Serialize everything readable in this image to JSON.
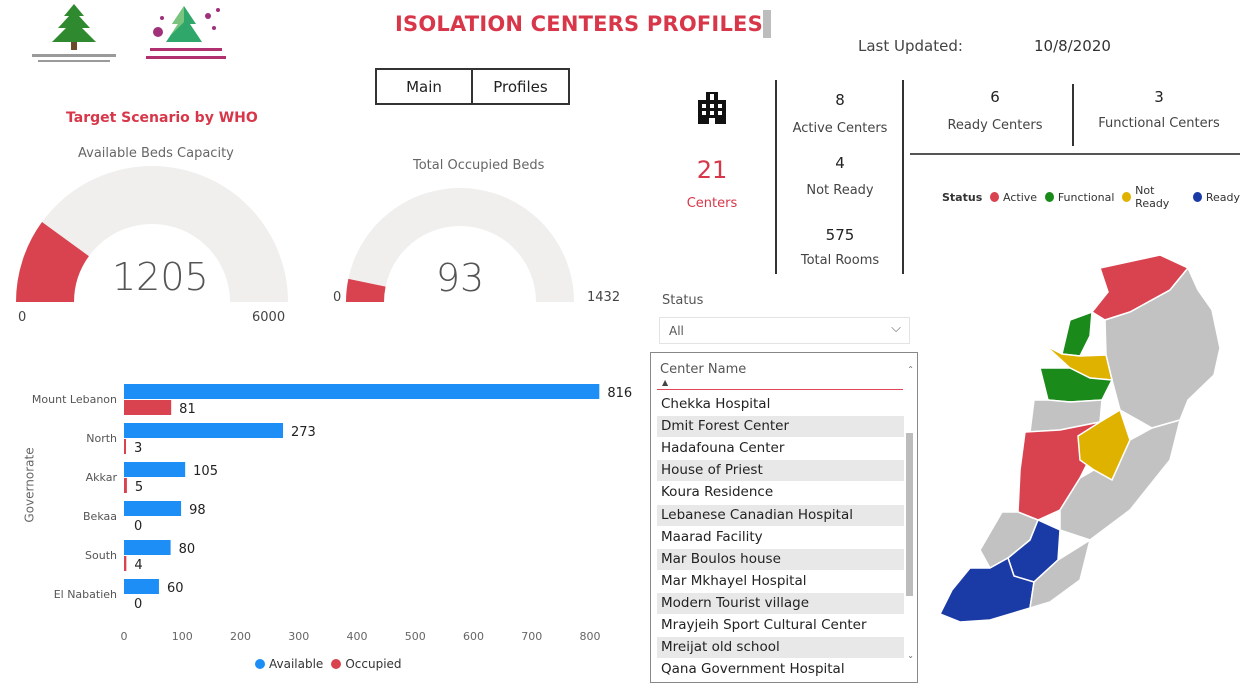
{
  "header": {
    "title": "ISOLATION CENTERS PROFILES",
    "last_updated_label": "Last Updated:",
    "last_updated_value": "10/8/2020"
  },
  "nav": {
    "main_label": "Main",
    "profiles_label": "Profiles"
  },
  "logos": {
    "left": "cedar-logo",
    "right": "covid-committee-logo"
  },
  "gauges": {
    "section_title": "Target Scenario by WHO",
    "available": {
      "title": "Available Beds Capacity",
      "value": "1205",
      "min": "0",
      "max": "6000",
      "fraction": 0.2
    },
    "occupied": {
      "title": "Total Occupied Beds",
      "value": "93",
      "min": "0",
      "max": "1432",
      "fraction": 0.065
    }
  },
  "kpis": {
    "centers_icon": "building-icon",
    "centers_count": "21",
    "centers_label": "Centers",
    "active_count": "8",
    "active_label": "Active Centers",
    "not_ready_count": "4",
    "not_ready_label": "Not Ready",
    "rooms_count": "575",
    "rooms_label": "Total Rooms",
    "ready_count": "6",
    "ready_label": "Ready Centers",
    "functional_count": "3",
    "functional_label": "Functional Centers"
  },
  "status_legend": {
    "title": "Status",
    "items": [
      {
        "label": "Active",
        "color": "#d9434f"
      },
      {
        "label": "Functional",
        "color": "#1a8a1a"
      },
      {
        "label": "Not Ready",
        "color": "#e0b200"
      },
      {
        "label": "Ready",
        "color": "#1a3aa6"
      }
    ]
  },
  "slicer": {
    "label": "Status",
    "value": "All",
    "list_header": "Center Name",
    "items": [
      "Chekka Hospital",
      "Dmit Forest Center",
      "Hadafouna Center",
      "House of Priest",
      "Koura Residence",
      "Lebanese Canadian Hospital",
      "Maarad Facility",
      "Mar Boulos house",
      "Mar Mkhayel Hospital",
      "Modern Tourist village",
      "Mrayjeih Sport Cultural Center",
      "Mreijat old school",
      "Qana Government Hospital"
    ]
  },
  "chart_data": {
    "type": "bar",
    "orientation": "horizontal",
    "categories": [
      "Mount Lebanon",
      "North",
      "Akkar",
      "Bekaa",
      "South",
      "El Nabatieh"
    ],
    "series": [
      {
        "name": "Available",
        "values": [
          816,
          273,
          105,
          98,
          80,
          60
        ],
        "color": "#1e8ef7"
      },
      {
        "name": "Occupied",
        "values": [
          81,
          3,
          5,
          0,
          4,
          0
        ],
        "color": "#d9434f"
      }
    ],
    "xticks": [
      "0",
      "100",
      "200",
      "300",
      "400",
      "500",
      "600",
      "700",
      "800"
    ],
    "xlim": [
      0,
      800
    ],
    "ylabel": "Governorate",
    "legend_position": "bottom"
  },
  "map": {
    "regions": [
      "Akkar",
      "North",
      "Mount Lebanon",
      "Bekaa",
      "South",
      "El Nabatieh"
    ]
  }
}
